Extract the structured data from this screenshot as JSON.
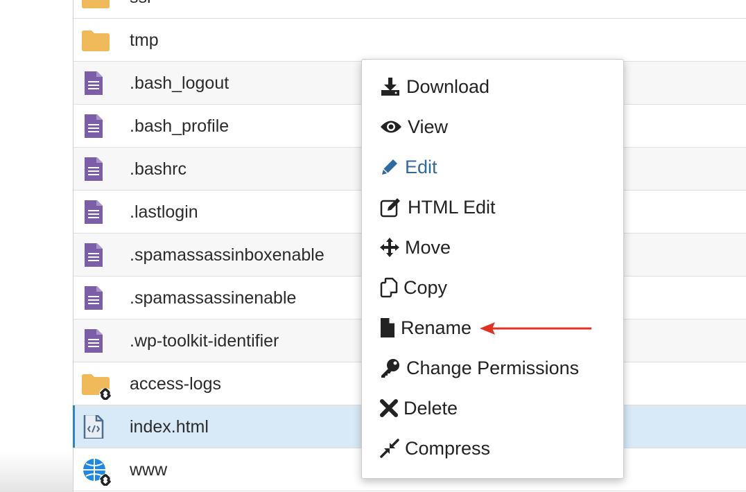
{
  "files": [
    {
      "name": "ssl",
      "type": "folder"
    },
    {
      "name": "tmp",
      "type": "folder"
    },
    {
      "name": ".bash_logout",
      "type": "text-file"
    },
    {
      "name": ".bash_profile",
      "type": "text-file"
    },
    {
      "name": ".bashrc",
      "type": "text-file"
    },
    {
      "name": ".lastlogin",
      "type": "text-file"
    },
    {
      "name": ".spamassassinboxenable",
      "type": "text-file"
    },
    {
      "name": ".spamassassinenable",
      "type": "text-file"
    },
    {
      "name": ".wp-toolkit-identifier",
      "type": "text-file"
    },
    {
      "name": "access-logs",
      "type": "folder-link"
    },
    {
      "name": "index.html",
      "type": "html-file",
      "selected": true
    },
    {
      "name": "www",
      "type": "globe-link"
    }
  ],
  "context_menu": {
    "items": [
      {
        "label": "Download",
        "icon": "download-icon"
      },
      {
        "label": "View",
        "icon": "eye-icon"
      },
      {
        "label": "Edit",
        "icon": "pencil-icon"
      },
      {
        "label": "HTML Edit",
        "icon": "edit-square-icon"
      },
      {
        "label": "Move",
        "icon": "move-icon"
      },
      {
        "label": "Copy",
        "icon": "copy-icon"
      },
      {
        "label": "Rename",
        "icon": "file-icon"
      },
      {
        "label": "Change Permissions",
        "icon": "key-icon"
      },
      {
        "label": "Delete",
        "icon": "x-icon"
      },
      {
        "label": "Compress",
        "icon": "compress-icon"
      }
    ]
  },
  "colors": {
    "folder": "#f0b95a",
    "text_file": "#7b5ea7",
    "html_file": "#4f6b8f",
    "selection": "#d8eaf7",
    "accent": "#2a84c6",
    "edit_link": "#2e6aa1",
    "annotation_arrow": "#e03121"
  }
}
